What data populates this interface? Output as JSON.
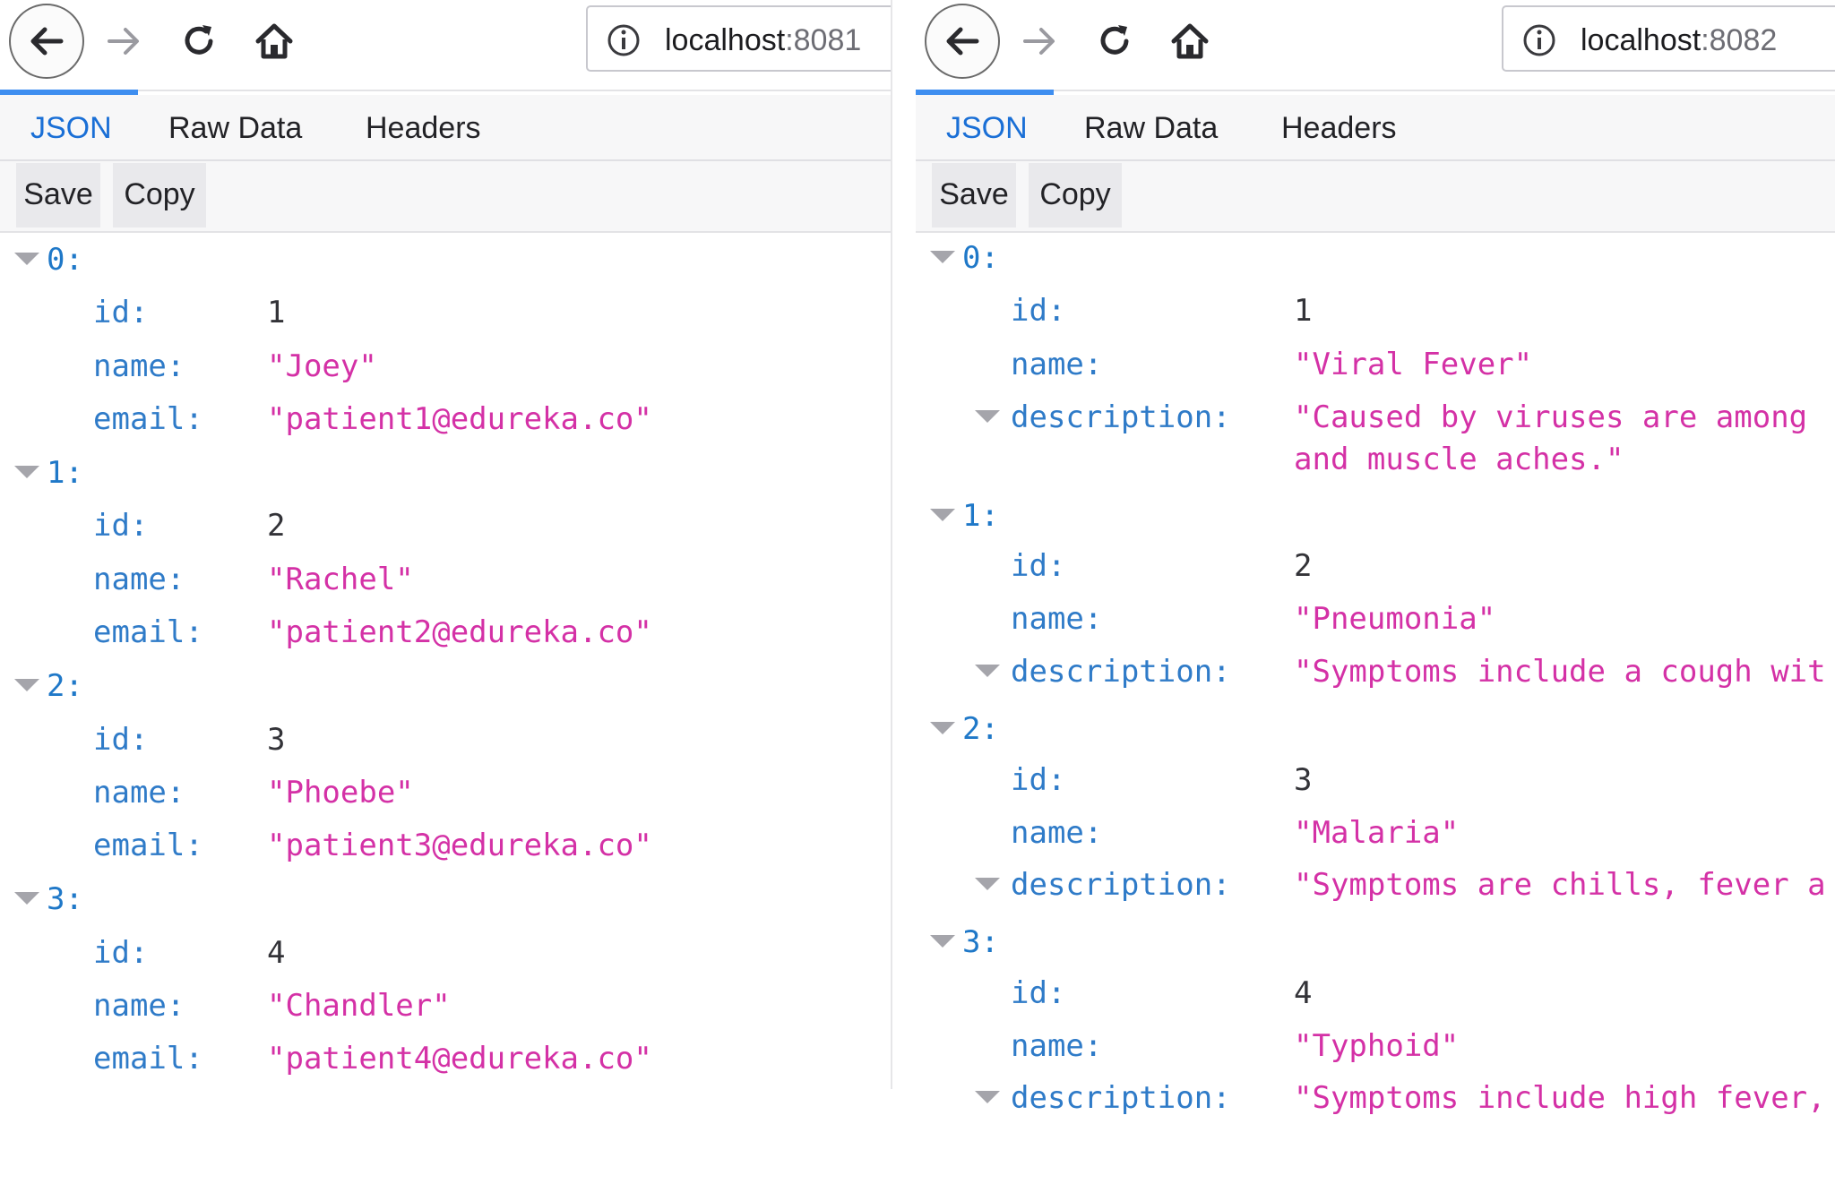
{
  "left": {
    "url": {
      "host": "localhost",
      "port": ":8081"
    },
    "tabs": {
      "json": "JSON",
      "raw": "Raw Data",
      "headers": "Headers"
    },
    "actions": {
      "save": "Save",
      "copy": "Copy"
    },
    "items": [
      {
        "index": "0:",
        "id_key": "id:",
        "id": "1",
        "name_key": "name:",
        "name": "\"Joey\"",
        "email_key": "email:",
        "email": "\"patient1@edureka.co\""
      },
      {
        "index": "1:",
        "id_key": "id:",
        "id": "2",
        "name_key": "name:",
        "name": "\"Rachel\"",
        "email_key": "email:",
        "email": "\"patient2@edureka.co\""
      },
      {
        "index": "2:",
        "id_key": "id:",
        "id": "3",
        "name_key": "name:",
        "name": "\"Phoebe\"",
        "email_key": "email:",
        "email": "\"patient3@edureka.co\""
      },
      {
        "index": "3:",
        "id_key": "id:",
        "id": "4",
        "name_key": "name:",
        "name": "\"Chandler\"",
        "email_key": "email:",
        "email": "\"patient4@edureka.co\""
      }
    ]
  },
  "right": {
    "url": {
      "host": "localhost",
      "port": ":8082"
    },
    "tabs": {
      "json": "JSON",
      "raw": "Raw Data",
      "headers": "Headers"
    },
    "actions": {
      "save": "Save",
      "copy": "Copy"
    },
    "items": [
      {
        "index": "0:",
        "id_key": "id:",
        "id": "1",
        "name_key": "name:",
        "name": "\"Viral Fever\"",
        "desc_key": "description:",
        "desc": "\"Caused by viruses are among",
        "desc2": "and muscle aches.\""
      },
      {
        "index": "1:",
        "id_key": "id:",
        "id": "2",
        "name_key": "name:",
        "name": "\"Pneumonia\"",
        "desc_key": "description:",
        "desc": "\"Symptoms include a cough wit"
      },
      {
        "index": "2:",
        "id_key": "id:",
        "id": "3",
        "name_key": "name:",
        "name": "\"Malaria\"",
        "desc_key": "description:",
        "desc": "\"Symptoms are chills, fever a"
      },
      {
        "index": "3:",
        "id_key": "id:",
        "id": "4",
        "name_key": "name:",
        "name": "\"Typhoid\"",
        "desc_key": "description:",
        "desc": "\"Symptoms include high fever,"
      }
    ]
  }
}
